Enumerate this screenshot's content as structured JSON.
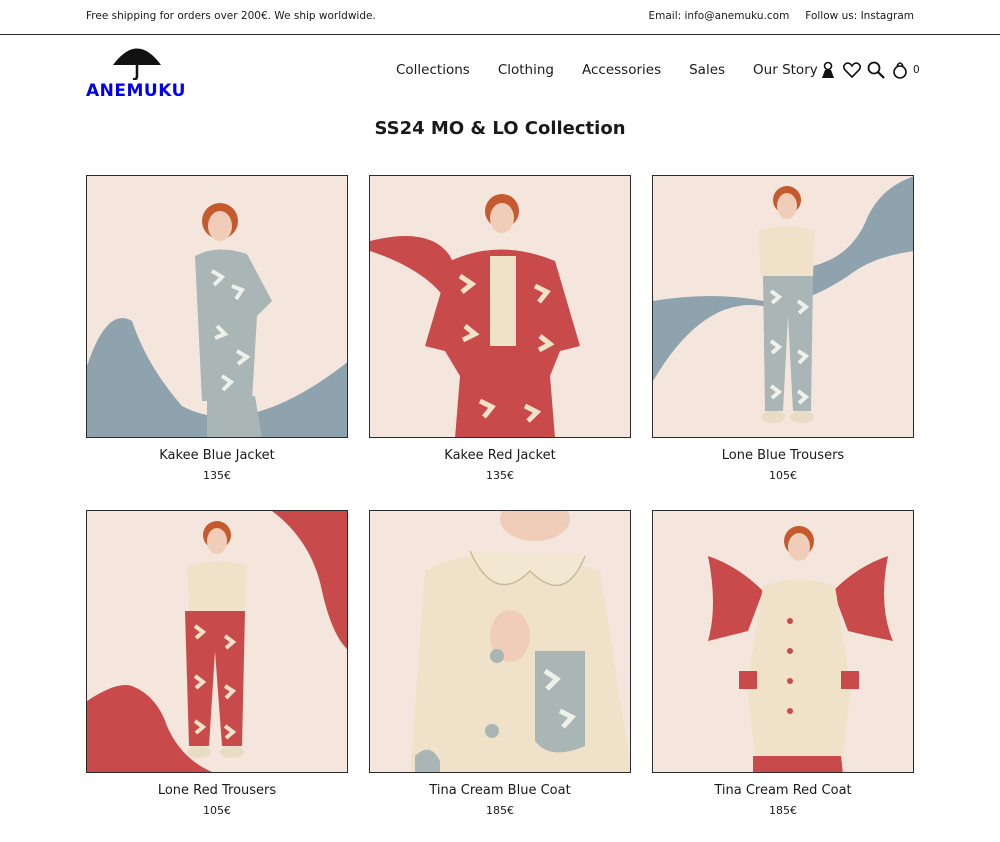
{
  "topbar": {
    "shipping": "Free shipping for orders over 200€. We ship worldwide.",
    "email": "Email: info@anemuku.com",
    "follow": "Follow us: Instagram"
  },
  "brand": {
    "name": "ANEMUKU"
  },
  "nav": [
    "Collections",
    "Clothing",
    "Accessories",
    "Sales",
    "Our Story"
  ],
  "header_icons": {
    "cart_count": "0",
    "names": [
      "user-icon",
      "heart-icon",
      "search-icon",
      "cart-icon"
    ]
  },
  "collection": {
    "title": "SS24 MO & LO Collection"
  },
  "products": [
    {
      "name": "Kakee Blue Jacket",
      "price": "135€",
      "accent": "#8ea3ad",
      "garment": "#a9b6b5"
    },
    {
      "name": "Kakee Red Jacket",
      "price": "135€",
      "accent": "#c94a4a",
      "garment": "#c94a4a"
    },
    {
      "name": "Lone Blue Trousers",
      "price": "105€",
      "accent": "#8ea3ad",
      "garment": "#a9b6b5"
    },
    {
      "name": "Lone Red Trousers",
      "price": "105€",
      "accent": "#c94a4a",
      "garment": "#c94a4a"
    },
    {
      "name": "Tina Cream Blue Coat",
      "price": "185€",
      "accent": "#8ea3ad",
      "garment": "#efe2c8"
    },
    {
      "name": "Tina Cream Red Coat",
      "price": "185€",
      "accent": "#c94a4a",
      "garment": "#efe2c8"
    }
  ],
  "colors": {
    "background": "#f4e6dc",
    "skin": "#f0cdb9",
    "hair": "#c55a2e"
  }
}
